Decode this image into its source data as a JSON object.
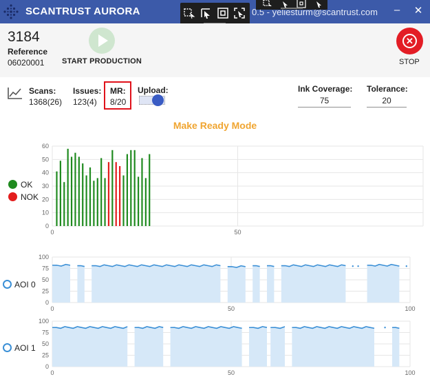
{
  "window": {
    "title": "SCANTRUST AURORA",
    "user": "0.5 - yeliesturm@scantrust.com",
    "minimize": "–",
    "close": "✕"
  },
  "header": {
    "job_number": "3184",
    "reference_label": "Reference",
    "reference_value": "06020001",
    "start_label": "START PRODUCTION",
    "stop_label": "STOP",
    "colors": {
      "start": "#cfe6cf",
      "stop": "#e31d25"
    }
  },
  "stats": {
    "scans_label": "Scans:",
    "scans_value": "1368(26)",
    "issues_label": "Issues:",
    "issues_value": "123(4)",
    "mr_label": "MR:",
    "mr_value": "8/20",
    "upload_label": "Upload:",
    "upload_on": true,
    "ink_coverage_label": "Ink Coverage:",
    "ink_coverage_value": "75",
    "tolerance_label": "Tolerance:",
    "tolerance_value": "20"
  },
  "mode_title": "Make Ready Mode",
  "legend": {
    "ok": "OK",
    "nok": "NOK",
    "ok_color": "#1f8a1f",
    "nok_color": "#e31d1d"
  },
  "aoi_labels": [
    "AOI 0",
    "AOI 1"
  ],
  "chart_data": [
    {
      "type": "bar",
      "title": "",
      "xlim": [
        0,
        100
      ],
      "ylim": [
        0,
        60
      ],
      "xticks": [
        0,
        50
      ],
      "yticks": [
        0,
        10,
        20,
        30,
        40,
        50,
        60
      ],
      "x": [
        1,
        2,
        3,
        4,
        5,
        6,
        7,
        8,
        9,
        10,
        11,
        12,
        13,
        14,
        15,
        16,
        17,
        18,
        19,
        20,
        21,
        22,
        23,
        24,
        25,
        26
      ],
      "values": [
        41,
        49,
        33,
        58,
        52,
        55,
        52,
        47,
        38,
        44,
        34,
        36,
        51,
        36,
        48,
        57,
        48,
        45,
        38,
        54,
        57,
        57,
        37,
        51,
        36,
        54
      ],
      "status": [
        "OK",
        "OK",
        "OK",
        "OK",
        "OK",
        "OK",
        "OK",
        "OK",
        "OK",
        "OK",
        "OK",
        "OK",
        "OK",
        "OK",
        "NOK",
        "OK",
        "NOK",
        "NOK",
        "OK",
        "OK",
        "OK",
        "OK",
        "OK",
        "OK",
        "OK",
        "OK"
      ],
      "colors": {
        "OK": "#1f8a1f",
        "NOK": "#e31d1d"
      }
    },
    {
      "type": "area",
      "name": "AOI 0",
      "xlim": [
        0,
        100
      ],
      "ylim": [
        0,
        100
      ],
      "xticks": [
        0,
        50,
        100
      ],
      "yticks": [
        0,
        25,
        50,
        75,
        100
      ],
      "segments": [
        {
          "x": [
            0,
            5
          ],
          "y": [
            82,
            82
          ]
        },
        {
          "x": [
            7,
            9
          ],
          "y": [
            81,
            81
          ]
        },
        {
          "x": [
            11,
            47
          ],
          "y": [
            81,
            81
          ]
        },
        {
          "x": [
            49,
            54
          ],
          "y": [
            79,
            79
          ]
        },
        {
          "x": [
            56,
            58
          ],
          "y": [
            81,
            81
          ]
        },
        {
          "x": [
            60,
            62
          ],
          "y": [
            81,
            81
          ]
        },
        {
          "x": [
            64,
            82
          ],
          "y": [
            81,
            81
          ]
        },
        {
          "x": [
            88,
            97
          ],
          "y": [
            82,
            82
          ]
        }
      ],
      "points": [
        [
          84,
          80
        ],
        [
          85.5,
          80
        ],
        [
          99,
          80
        ]
      ],
      "color": "#3a8fd6",
      "fill": "#d6e8f8"
    },
    {
      "type": "area",
      "name": "AOI 1",
      "xlim": [
        0,
        100
      ],
      "ylim": [
        0,
        100
      ],
      "xticks": [
        0,
        50,
        100
      ],
      "yticks": [
        0,
        25,
        50,
        75,
        100
      ],
      "segments": [
        {
          "x": [
            0,
            21
          ],
          "y": [
            86,
            86
          ]
        },
        {
          "x": [
            23,
            31
          ],
          "y": [
            86,
            86
          ]
        },
        {
          "x": [
            33,
            53
          ],
          "y": [
            86,
            86
          ]
        },
        {
          "x": [
            55,
            60
          ],
          "y": [
            86,
            86
          ]
        },
        {
          "x": [
            61,
            65
          ],
          "y": [
            86,
            86
          ]
        },
        {
          "x": [
            67,
            90
          ],
          "y": [
            86,
            86
          ]
        },
        {
          "x": [
            95,
            97
          ],
          "y": [
            86,
            86
          ]
        }
      ],
      "points": [
        [
          93,
          86
        ]
      ],
      "color": "#3a8fd6",
      "fill": "#d6e8f8"
    }
  ]
}
